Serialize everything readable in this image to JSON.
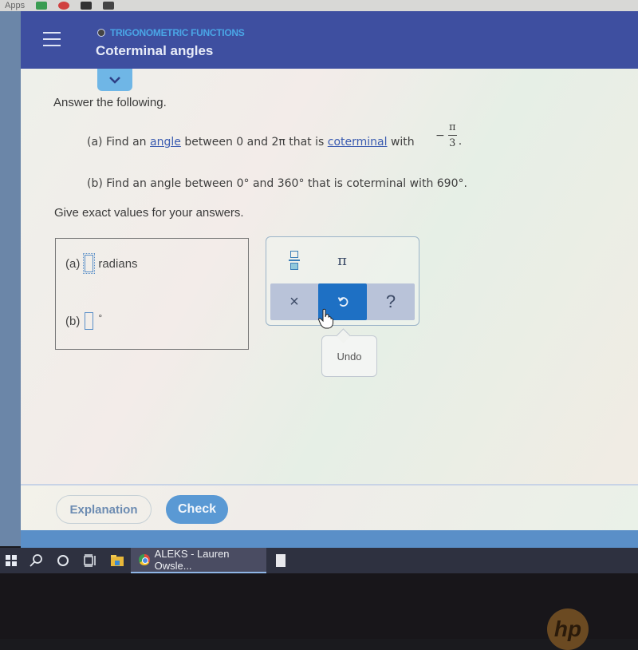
{
  "bookmarks_bar": {
    "apps_label": "Apps"
  },
  "header": {
    "topic": "TRIGONOMETRIC FUNCTIONS",
    "title": "Coterminal angles",
    "accent_color": "#3e4fa0",
    "topic_color": "#4aa6e6"
  },
  "problem": {
    "instruction": "Answer the following.",
    "part_a": {
      "label": "(a)",
      "text_1": "Find an",
      "link_1": "angle",
      "text_2": "between 0 and 2π that is",
      "link_2": "coterminal",
      "text_3": "with",
      "value_sign": "−",
      "value_numerator": "π",
      "value_denominator": "3",
      "end": "."
    },
    "part_b": {
      "label": "(b)",
      "text": "Find an angle between 0° and 360° that is coterminal with 690°."
    },
    "note": "Give exact values for your answers."
  },
  "answers": {
    "a": {
      "label": "(a)",
      "value": "",
      "unit": "radians"
    },
    "b": {
      "label": "(b)",
      "value": "",
      "unit": "°"
    }
  },
  "keypad": {
    "fraction_key": "fraction-template",
    "pi_key": "π",
    "clear_key": "×",
    "undo_key": "undo",
    "help_key": "?",
    "tooltip": "Undo"
  },
  "footer": {
    "explanation_label": "Explanation",
    "check_label": "Check",
    "check_color": "#5a99d4"
  },
  "taskbar": {
    "active_app": "ALEKS - Lauren Owsle..."
  },
  "bezel": {
    "brand": "hp"
  }
}
